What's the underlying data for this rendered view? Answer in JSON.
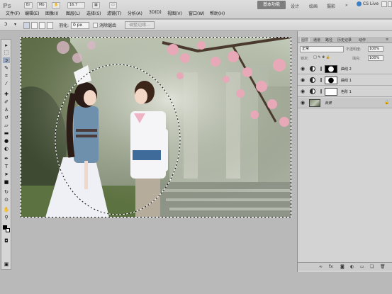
{
  "app": {
    "logo": "Ps"
  },
  "menu": {
    "items": [
      "文件(F)",
      "编辑(E)",
      "图像(I)",
      "图层(L)",
      "选择(S)",
      "滤镜(T)",
      "分析(A)",
      "3D(D)",
      "视图(V)",
      "窗口(W)",
      "帮助(H)"
    ]
  },
  "topbar": {
    "zoom": "16.7",
    "workspace": "基本功能",
    "links": [
      "设计",
      "绘画",
      "摄影"
    ],
    "cslive": "CS Live"
  },
  "options": {
    "feather_label": "羽化:",
    "feather_value": "0 px",
    "antialias_label": "消除锯齿",
    "refine_label": "调整边缘..."
  },
  "layers_panel": {
    "tabs": [
      "图层",
      "通道",
      "路径",
      "历史记录",
      "动作"
    ],
    "blend_mode": "正常",
    "opacity_label": "不透明度:",
    "opacity_value": "100%",
    "lock_label": "锁定:",
    "fill_label": "填充:",
    "fill_value": "100%",
    "layers": [
      {
        "name": "曲线 2",
        "type": "curves"
      },
      {
        "name": "曲线 1",
        "type": "curves"
      },
      {
        "name": "色阶 1",
        "type": "levels"
      },
      {
        "name": "背景",
        "type": "background"
      }
    ]
  },
  "colors": {
    "workspace_bg": "#b9b9b9",
    "panel_bg": "#d3d3d3",
    "accent": "#3b7fc6"
  }
}
